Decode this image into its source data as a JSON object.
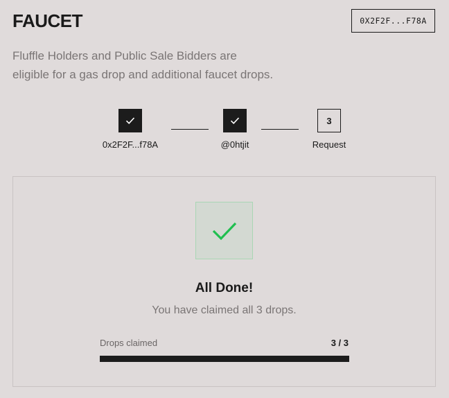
{
  "header": {
    "title": "FAUCET",
    "wallet_address": "0X2F2F...F78A"
  },
  "description": {
    "line1": "Fluffle Holders and Public Sale Bidders are",
    "line2": "eligible for a gas drop and additional faucet drops."
  },
  "steps": [
    {
      "label": "0x2F2F...f78A",
      "status": "done",
      "icon": "check-icon"
    },
    {
      "label": "@0htjit",
      "status": "done",
      "icon": "check-icon"
    },
    {
      "label": "Request",
      "status": "pending",
      "number": "3"
    }
  ],
  "result": {
    "icon": "check-icon",
    "title": "All Done!",
    "subtitle": "You have claimed all 3 drops.",
    "progress_label": "Drops claimed",
    "progress_count": "3 / 3",
    "progress_fraction": 1.0
  },
  "colors": {
    "background": "#e0dbdb",
    "dark": "#1c1c1c",
    "success": "#1fbf4f",
    "muted_text": "#7a7575"
  }
}
